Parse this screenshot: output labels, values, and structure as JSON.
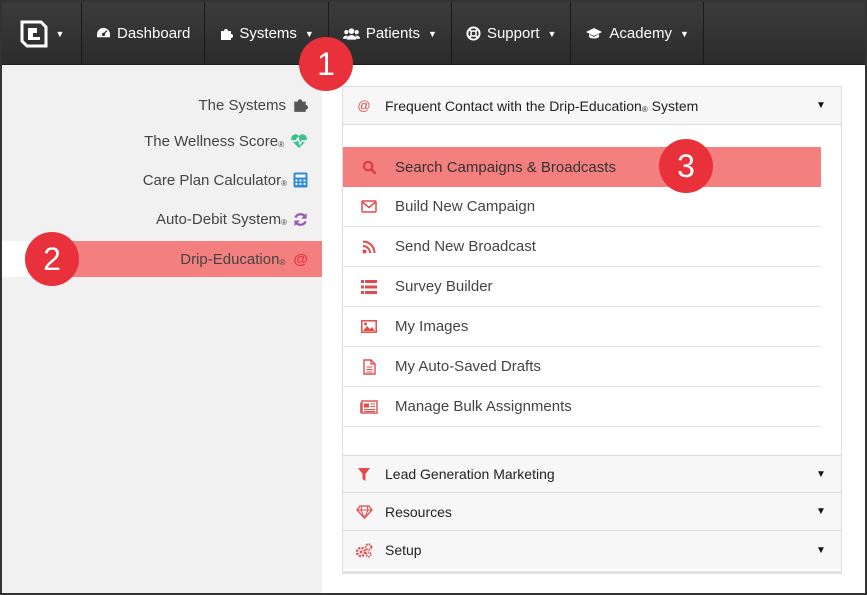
{
  "nav": {
    "items": [
      {
        "label": "Dashboard",
        "icon": "dashboard-icon"
      },
      {
        "label": "Systems",
        "icon": "puzzle-icon"
      },
      {
        "label": "Patients",
        "icon": "users-icon"
      },
      {
        "label": "Support",
        "icon": "lifebuoy-icon"
      },
      {
        "label": "Academy",
        "icon": "graduation-cap-icon"
      }
    ]
  },
  "sidebar": {
    "items": [
      {
        "label": "The Systems",
        "reg": "",
        "icon": "puzzle-icon"
      },
      {
        "label": "The Wellness Score",
        "reg": "®",
        "icon": "heartbeat-icon"
      },
      {
        "label": "Care Plan Calculator",
        "reg": "®",
        "icon": "calculator-icon"
      },
      {
        "label": "Auto-Debit System",
        "reg": "®",
        "icon": "refresh-icon"
      },
      {
        "label": "Drip-Education",
        "reg": "®",
        "icon": "at-icon"
      }
    ]
  },
  "panel": {
    "header": {
      "label": "Frequent Contact with the Drip-Education",
      "reg": "®",
      "suffix": " System",
      "icon": "at-icon"
    },
    "items": [
      {
        "label": "Search Campaigns & Broadcasts",
        "icon": "search-icon"
      },
      {
        "label": "Build New Campaign",
        "icon": "envelope-icon"
      },
      {
        "label": "Send New Broadcast",
        "icon": "rss-icon"
      },
      {
        "label": "Survey Builder",
        "icon": "list-icon"
      },
      {
        "label": "My Images",
        "icon": "image-icon"
      },
      {
        "label": "My Auto-Saved Drafts",
        "icon": "file-icon"
      },
      {
        "label": "Manage Bulk Assignments",
        "icon": "newspaper-icon"
      }
    ],
    "sections": [
      {
        "label": "Lead Generation Marketing",
        "icon": "filter-icon"
      },
      {
        "label": "Resources",
        "icon": "diamond-icon"
      },
      {
        "label": "Setup",
        "icon": "cogs-icon"
      }
    ]
  },
  "badges": {
    "one": "1",
    "two": "2",
    "three": "3"
  },
  "colors": {
    "accent": "#e34b4b",
    "highlight": "#f47f7f",
    "badge": "#e8313a",
    "nav": "#333333"
  }
}
